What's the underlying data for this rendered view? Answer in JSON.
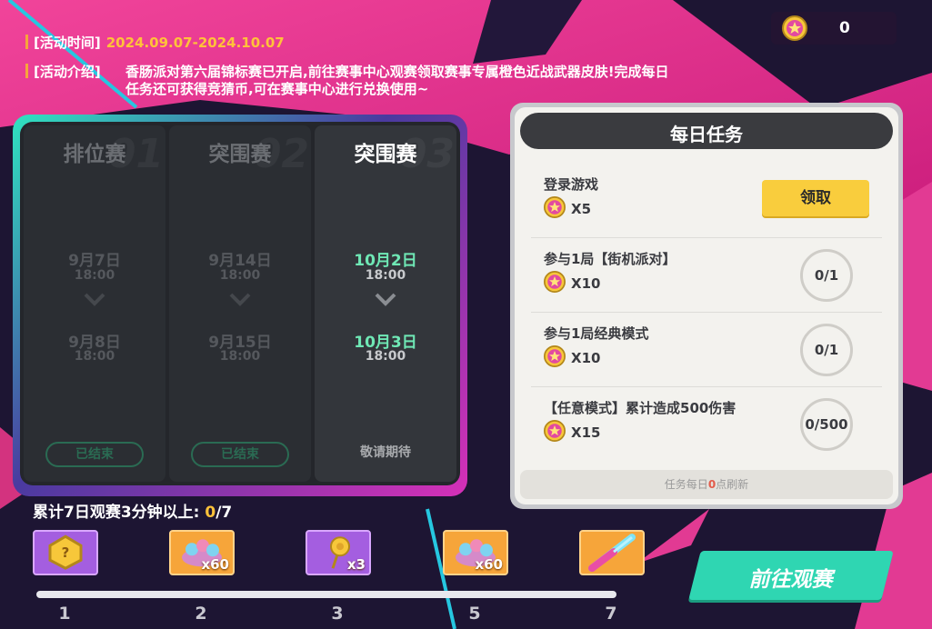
{
  "header": {
    "coin_icon": "star-coin-icon",
    "coin_count": "0"
  },
  "event": {
    "time_label": "[活动时间]",
    "time_value": "2024.09.07-2024.10.07",
    "intro_label": "[活动介绍]",
    "intro_text": "香肠派对第六届锦标赛已开启,前往赛事中心观赛领取赛事专属橙色近战武器皮肤!完成每日任务还可获得竞猜币,可在赛事中心进行兑换使用~"
  },
  "schedule": [
    {
      "ghost": "01",
      "title": "排位赛",
      "start_date": "9月7日",
      "start_time": "18:00",
      "end_date": "9月8日",
      "end_time": "18:00",
      "status": "已结束",
      "state": "ended"
    },
    {
      "ghost": "02",
      "title": "突围赛",
      "start_date": "9月14日",
      "start_time": "18:00",
      "end_date": "9月15日",
      "end_time": "18:00",
      "status": "已结束",
      "state": "ended"
    },
    {
      "ghost": "03",
      "title": "突围赛",
      "start_date": "10月2日",
      "start_time": "18:00",
      "end_date": "10月3日",
      "end_time": "18:00",
      "status": "敬请期待",
      "state": "upcoming"
    }
  ],
  "tasks": {
    "title": "每日任务",
    "items": [
      {
        "name": "登录游戏",
        "reward": "X5",
        "action": "领取"
      },
      {
        "name": "参与1局【街机派对】",
        "reward": "X10",
        "progress": "0/1"
      },
      {
        "name": "参与1局经典模式",
        "reward": "X10",
        "progress": "0/1"
      },
      {
        "name": "【任意模式】累计造成500伤害",
        "reward": "X15",
        "progress": "0/500"
      }
    ],
    "footer_prefix": "任务每日",
    "footer_num": "0",
    "footer_suffix": "点刷新"
  },
  "watch": {
    "label": "累计7日观赛3分钟以上: ",
    "current": "0",
    "total": "/7",
    "progress_fraction": 0,
    "rewards": [
      {
        "icon": "gold-badge-icon",
        "count": "",
        "bg": "purple",
        "day": "1"
      },
      {
        "icon": "gem-pile-icon",
        "count": "x60",
        "bg": "orange",
        "day": "2"
      },
      {
        "icon": "gold-rose-icon",
        "count": "x3",
        "bg": "purple",
        "day": "3"
      },
      {
        "icon": "gem-pile-icon",
        "count": "x60",
        "bg": "orange",
        "day": "5"
      },
      {
        "icon": "melee-weapon-icon",
        "count": "",
        "bg": "orange",
        "day": "7"
      }
    ]
  },
  "go_button": "前往观赛",
  "colors": {
    "accent_yellow": "#ffc23a",
    "accent_teal": "#2fd6b2",
    "upcoming_green": "#6fe8b5",
    "claim_yellow": "#f9cd3d"
  }
}
